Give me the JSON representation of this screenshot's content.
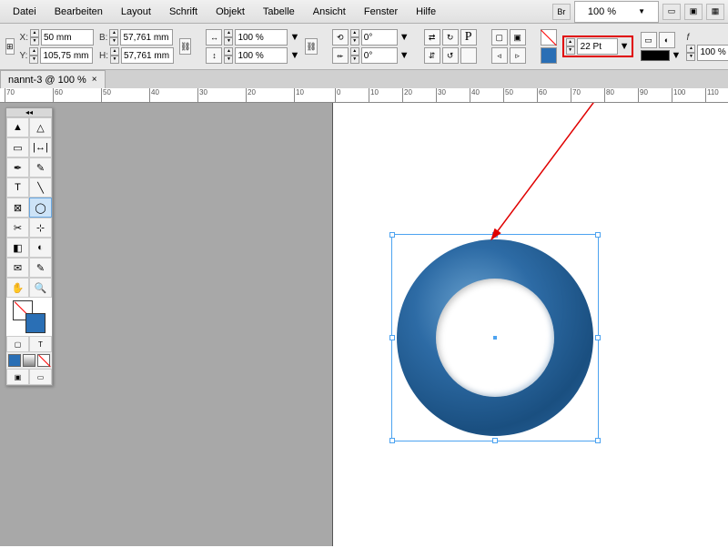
{
  "menu": {
    "items": [
      "Datei",
      "Bearbeiten",
      "Layout",
      "Schrift",
      "Objekt",
      "Tabelle",
      "Ansicht",
      "Fenster",
      "Hilfe"
    ],
    "zoom": "100 %",
    "br": "Br"
  },
  "toolbar": {
    "x_label": "X:",
    "x_val": "50 mm",
    "y_label": "Y:",
    "y_val": "105,75 mm",
    "w_label": "B:",
    "w_val": "57,761 mm",
    "h_label": "H:",
    "h_val": "57,761 mm",
    "scale_x": "100 %",
    "scale_y": "100 %",
    "rot": "0°",
    "shear": "0°",
    "stroke_weight": "22 Pt",
    "opacity": "100 %"
  },
  "tab": {
    "title": "nannt-3 @ 100 %",
    "close": "×"
  },
  "ruler_ticks": [
    "70",
    "60",
    "50",
    "40",
    "30",
    "20",
    "10",
    "0",
    "10",
    "20",
    "30",
    "40",
    "50",
    "60",
    "70",
    "80",
    "90",
    "100",
    "110"
  ],
  "swatches": {
    "a": "#2a6fb5",
    "b": "#d0d0d0",
    "c": "#ffffff"
  }
}
